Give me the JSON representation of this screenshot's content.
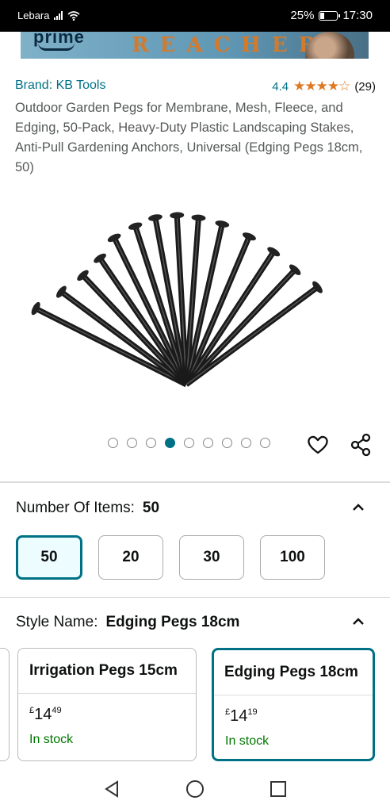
{
  "status_bar": {
    "carrier": "Lebara",
    "battery_percent": "25%",
    "battery_level": 0.25,
    "time": "17:30"
  },
  "banner": {
    "left_text": "prime",
    "title": "REACHER"
  },
  "product": {
    "brand": "Brand: KB Tools",
    "rating_value": "4.4",
    "stars": "★★★★☆",
    "rating_count": "(29)",
    "title": "Outdoor Garden Pegs for Membrane, Mesh, Fleece, and Edging, 50-Pack, Heavy-Duty Plastic Landscaping Stakes, Anti-Pull Gardening Anchors, Universal (Edging Pegs 18cm, 50)"
  },
  "gallery": {
    "image_count": 9,
    "active_index": 3,
    "image_icon": "garden-pegs-image"
  },
  "number_of_items": {
    "label": "Number Of Items:",
    "selected": "50",
    "options": [
      "50",
      "20",
      "30",
      "100"
    ]
  },
  "style_name": {
    "label": "Style Name:",
    "selected": "Edging Pegs 18cm",
    "options": [
      {
        "name": "Irrigation Pegs 15cm",
        "currency": "£",
        "price_whole": "14",
        "price_fraction": "49",
        "stock": "In stock"
      },
      {
        "name": "Edging Pegs 18cm",
        "currency": "£",
        "price_whole": "14",
        "price_fraction": "19",
        "stock": "In stock"
      }
    ]
  },
  "colors": {
    "accent": "#007185",
    "stars": "#de7921",
    "in_stock": "#007600"
  }
}
